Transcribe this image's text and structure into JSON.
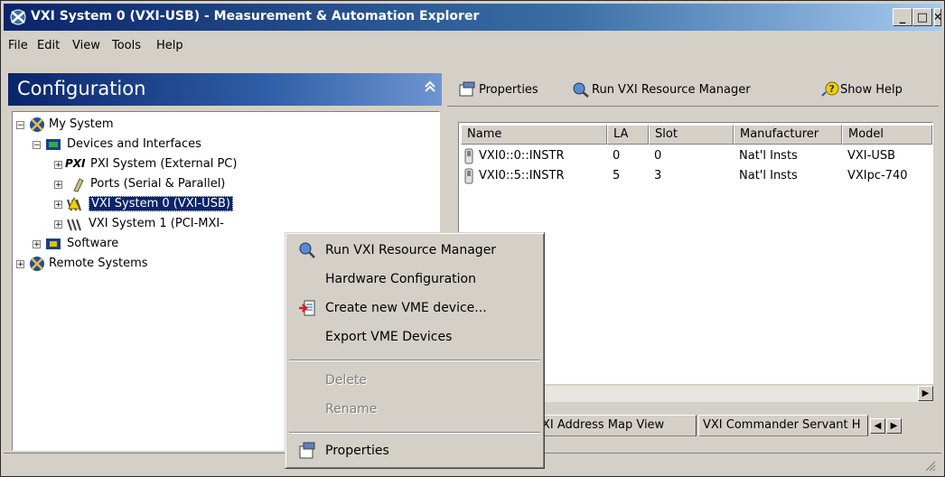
{
  "window": {
    "title": "VXI System 0 (VXI-USB) - Measurement & Automation Explorer",
    "controls": {
      "minimize": "_",
      "maximize": "□",
      "close": "✕"
    }
  },
  "menubar": [
    {
      "label": "File"
    },
    {
      "label": "Edit"
    },
    {
      "label": "View"
    },
    {
      "label": "Tools"
    },
    {
      "label": "Help"
    }
  ],
  "config_panel": {
    "title": "Configuration",
    "collapse_icon": "double-chevron-up-icon"
  },
  "tree": [
    {
      "label": "My System",
      "expander": "−",
      "icon": "my-system-icon"
    },
    {
      "label": "Devices and Interfaces",
      "expander": "−",
      "icon": "devices-folder-icon"
    },
    {
      "label": "PXI System (External PC)",
      "expander": "+",
      "icon": "pxi-icon",
      "icon_text": "PXI"
    },
    {
      "label": "Ports (Serial & Parallel)",
      "expander": "+",
      "icon": "ports-icon"
    },
    {
      "label": "VXI System 0 (VXI-USB)",
      "expander": "+",
      "icon": "vxi-warning-icon",
      "selected": true
    },
    {
      "label": "VXI System 1 (PCI-MXI-",
      "expander": "+",
      "icon": "vxi-icon"
    },
    {
      "label": "Software",
      "expander": "+",
      "icon": "software-icon"
    },
    {
      "label": "Remote Systems",
      "expander": "+",
      "icon": "remote-systems-icon"
    }
  ],
  "toolbar": {
    "properties": "Properties",
    "run_vxi": "Run VXI Resource Manager",
    "show_help": "Show Help"
  },
  "list": {
    "columns": [
      "Name",
      "LA",
      "Slot",
      "Manufacturer",
      "Model"
    ],
    "rows": [
      {
        "name": "VXI0::0::INSTR",
        "la": "0",
        "slot": "0",
        "manufacturer": "Nat'l Insts",
        "model": "VXI-USB"
      },
      {
        "name": "VXI0::5::INSTR",
        "la": "5",
        "slot": "3",
        "manufacturer": "Nat'l Insts",
        "model": "VXIpc-740"
      }
    ]
  },
  "tabs": [
    {
      "label": "XI Address Map View"
    },
    {
      "label": "VXI Commander Servant H"
    }
  ],
  "context_menu": {
    "items": [
      {
        "label": "Run VXI Resource Manager",
        "icon": "run-vxi-icon",
        "disabled": false
      },
      {
        "label": "Hardware Configuration",
        "disabled": false
      },
      {
        "label": "Create new VME device...",
        "icon": "create-vme-icon",
        "disabled": false
      },
      {
        "label": "Export VME Devices",
        "disabled": false
      },
      {
        "label": "Delete",
        "disabled": true
      },
      {
        "label": "Rename",
        "disabled": true
      },
      {
        "label": "Properties",
        "icon": "properties-icon",
        "disabled": false
      }
    ]
  }
}
